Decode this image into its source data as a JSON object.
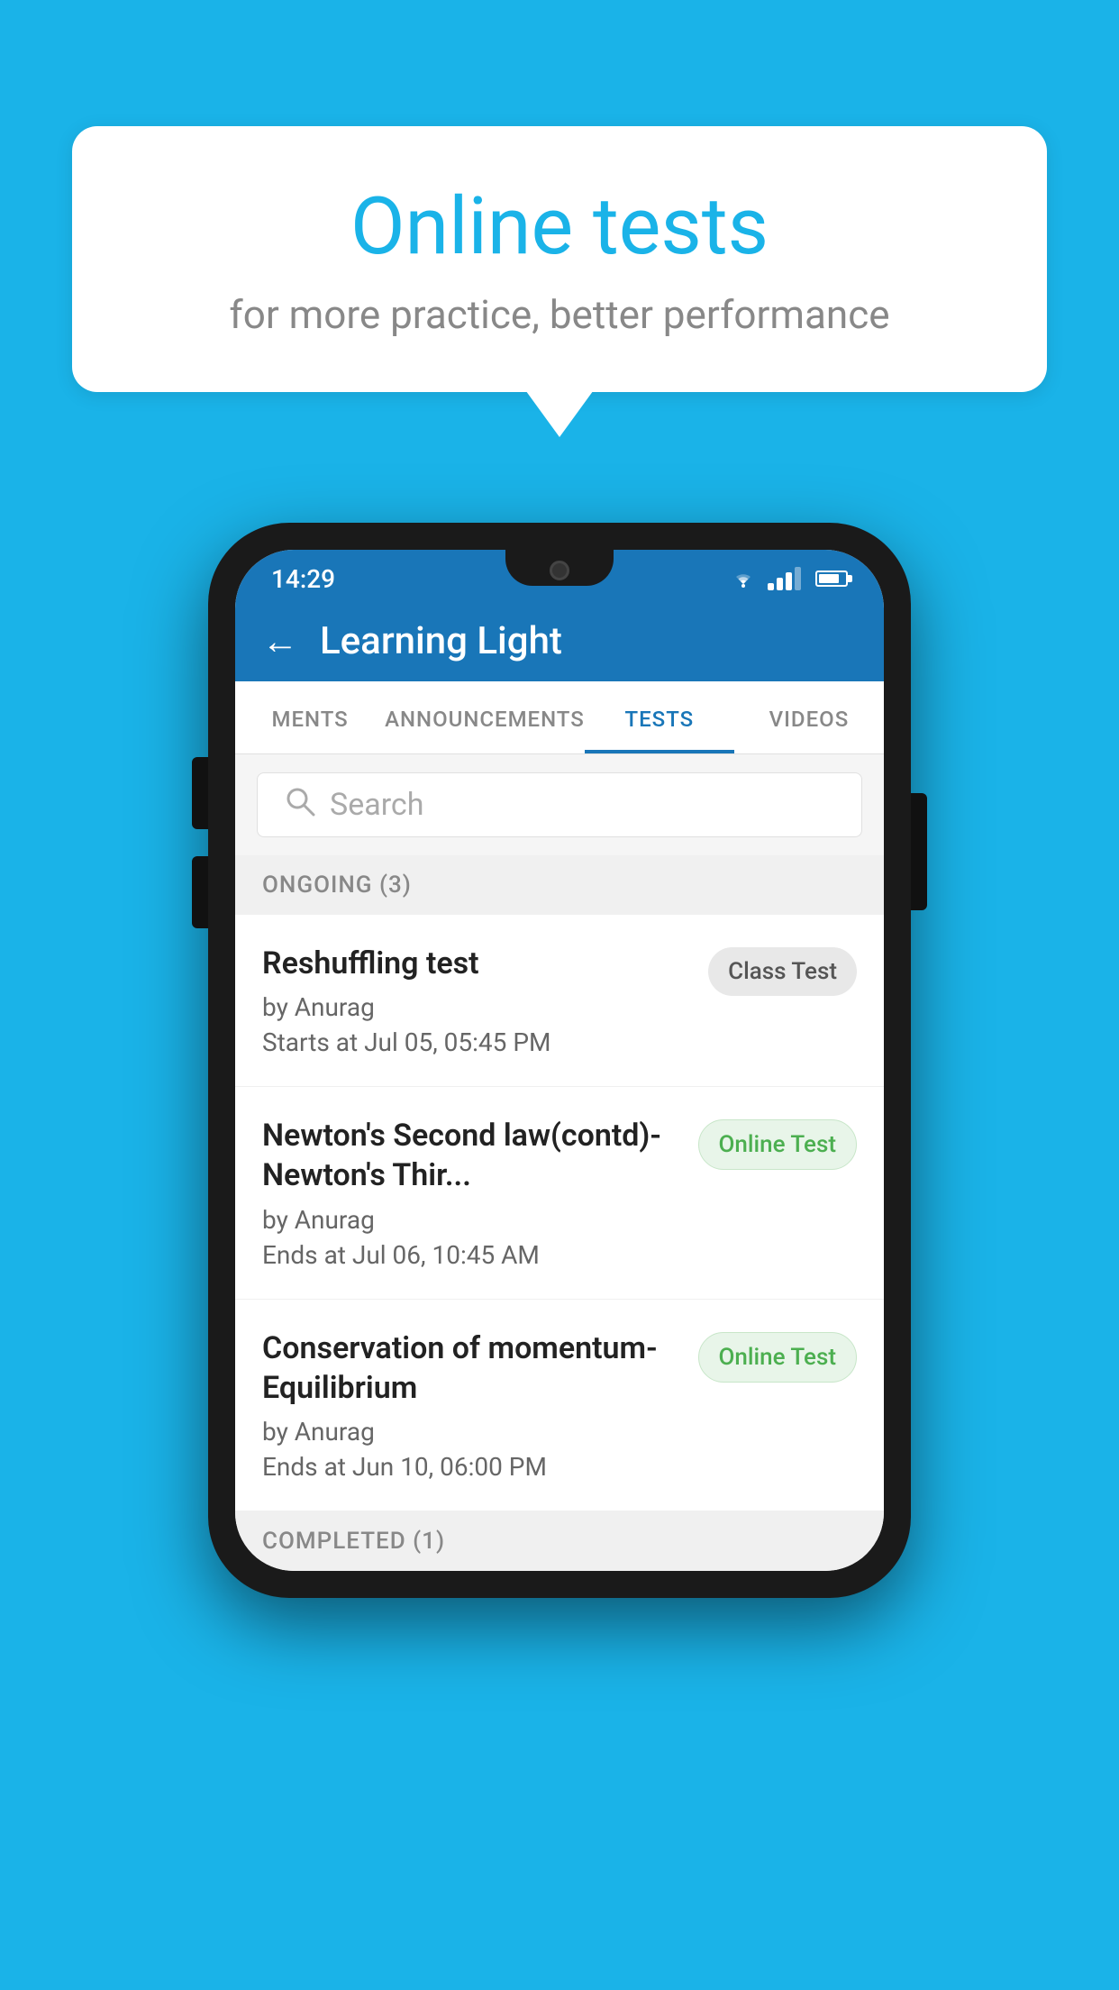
{
  "background": {
    "color": "#1ab3e8"
  },
  "speech_bubble": {
    "title": "Online tests",
    "subtitle": "for more practice, better performance"
  },
  "phone": {
    "status_bar": {
      "time": "14:29"
    },
    "header": {
      "title": "Learning Light",
      "back_label": "←"
    },
    "tabs": [
      {
        "id": "ments",
        "label": "MENTS",
        "active": false
      },
      {
        "id": "announcements",
        "label": "ANNOUNCEMENTS",
        "active": false
      },
      {
        "id": "tests",
        "label": "TESTS",
        "active": true
      },
      {
        "id": "videos",
        "label": "VIDEOS",
        "active": false
      }
    ],
    "search": {
      "placeholder": "Search"
    },
    "ongoing_section": {
      "label": "ONGOING (3)"
    },
    "tests": [
      {
        "id": 1,
        "name": "Reshuffling test",
        "author": "by Anurag",
        "date": "Starts at  Jul 05, 05:45 PM",
        "badge": "Class Test",
        "badge_type": "class"
      },
      {
        "id": 2,
        "name": "Newton's Second law(contd)-Newton's Thir...",
        "author": "by Anurag",
        "date": "Ends at  Jul 06, 10:45 AM",
        "badge": "Online Test",
        "badge_type": "online"
      },
      {
        "id": 3,
        "name": "Conservation of momentum-Equilibrium",
        "author": "by Anurag",
        "date": "Ends at  Jun 10, 06:00 PM",
        "badge": "Online Test",
        "badge_type": "online"
      }
    ],
    "completed_section": {
      "label": "COMPLETED (1)"
    }
  }
}
